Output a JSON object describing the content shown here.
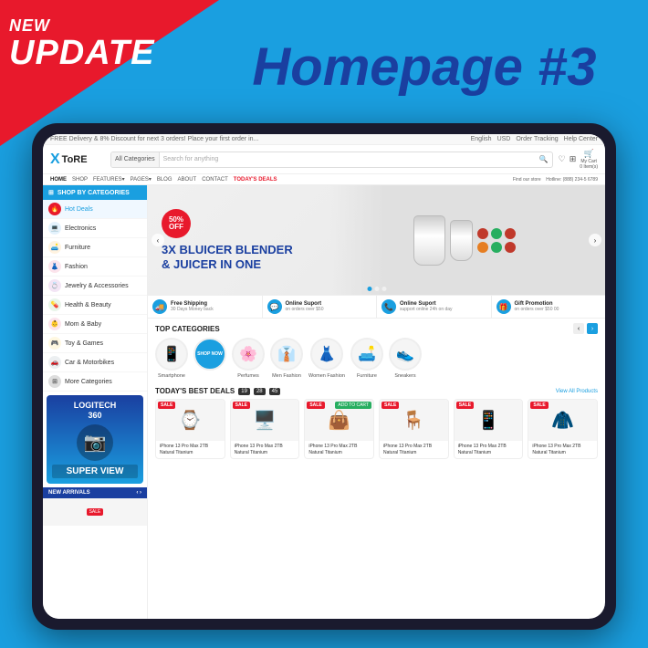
{
  "page": {
    "background_color": "#1a9fe0",
    "corner_label_new": "NEW",
    "corner_label_update": "UPDATE",
    "main_title": "Homepage #3"
  },
  "store": {
    "topbar_left": "FREE Delivery & 8% Discount for next 3 orders! Place your first order in...",
    "topbar_right_lang": "English",
    "topbar_right_usd": "USD",
    "topbar_right_track": "Order Tracking",
    "topbar_right_help": "Help Center",
    "logo_x": "X",
    "logo_text": "ToRE",
    "search_category": "All Categories",
    "search_placeholder": "Search for anything",
    "nav_items": [
      "HOME",
      "SHOP",
      "FEATURES+",
      "PAGES+",
      "BLOG",
      "ABOUT",
      "CONTACT",
      "TODAY'S DEALS"
    ],
    "store_info": "Find our store",
    "hotline_label": "Hotline: (888) 234-5 6789",
    "cart_label": "My Cart",
    "cart_items": "0 Item(s)"
  },
  "sidebar": {
    "header": "SHOP BY CATEGORIES",
    "items": [
      {
        "label": "Hot Deals",
        "color": "#e8192c"
      },
      {
        "label": "Electronics",
        "color": "#1a9fe0"
      },
      {
        "label": "Furniture",
        "color": "#f39c12"
      },
      {
        "label": "Fashion",
        "color": "#e91e63"
      },
      {
        "label": "Jewelry & Accessories",
        "color": "#9b59b6"
      },
      {
        "label": "Health & Beauty",
        "color": "#27ae60"
      },
      {
        "label": "Mom & Baby",
        "color": "#e91e63"
      },
      {
        "label": "Toy & Games",
        "color": "#f39c12"
      },
      {
        "label": "Car & Motorbikes",
        "color": "#34495e"
      },
      {
        "label": "More Categories",
        "color": "#666"
      }
    ]
  },
  "hero": {
    "badge_percent": "50%",
    "badge_off": "OFF",
    "title_line1": "3X BLUICER BLENDER",
    "title_line2": "& JUICER IN ONE"
  },
  "features": [
    {
      "icon": "🚚",
      "title": "Free Shipping",
      "desc": "30 Days Money back"
    },
    {
      "icon": "💬",
      "title": "Online Suport",
      "desc": "on orders over $50"
    },
    {
      "icon": "📞",
      "title": "Online Suport",
      "desc": "support online 24h on day"
    },
    {
      "icon": "🎁",
      "title": "Gift Promotion",
      "desc": "on orders over $50 00"
    }
  ],
  "top_categories": {
    "section_title": "TOP CATEGORIES",
    "items": [
      {
        "label": "Smartphone",
        "emoji": "📱"
      },
      {
        "label": "SHOP NOW",
        "special": true
      },
      {
        "label": "Perfumes",
        "emoji": "🌸"
      },
      {
        "label": "Men Fashion",
        "emoji": "👔"
      },
      {
        "label": "Women Fashion",
        "emoji": "👗"
      },
      {
        "label": "Furniture",
        "emoji": "🛋️"
      },
      {
        "label": "Sneakers",
        "emoji": "👟"
      }
    ]
  },
  "deals": {
    "section_title": "TODAY'S BEST DEALS",
    "timer": [
      "19",
      "28",
      "45"
    ],
    "view_all": "View All Products",
    "items": [
      {
        "name": "iPhone 13 Pro Max 2TB Natural Titanium",
        "emoji": "⌚",
        "sale": "SALE"
      },
      {
        "name": "iPhone 13 Pro Max 2TB Natural Titanium",
        "emoji": "🖥️",
        "sale": "SALE"
      },
      {
        "name": "iPhone 13 Pro Max 2TB Natural Titanium",
        "emoji": "👜",
        "sale": "SALE"
      },
      {
        "name": "iPhone 13 Pro Max 2TB Natural Titanium",
        "emoji": "🪑",
        "sale": "SALE"
      },
      {
        "name": "iPhone 13 Pro Max 2TB Natural Titanium",
        "emoji": "📱",
        "sale": "SALE"
      },
      {
        "name": "iPhone 13 Pro Max 2TB Natural Titanium",
        "emoji": "🧥",
        "sale": "SALE"
      }
    ]
  },
  "promo": {
    "brand": "LOGITECH",
    "model": "360",
    "tagline": "SUPER VIEW",
    "new_arrivals": "NEW ARRIVALS"
  },
  "icons": {
    "grid": "⊞",
    "heart": "♡",
    "user": "👤",
    "cart": "🛒",
    "search": "🔍",
    "chevron_left": "‹",
    "chevron_right": "›",
    "arrow_left": "←",
    "arrow_right": "→",
    "phone": "📞",
    "location": "📍"
  }
}
